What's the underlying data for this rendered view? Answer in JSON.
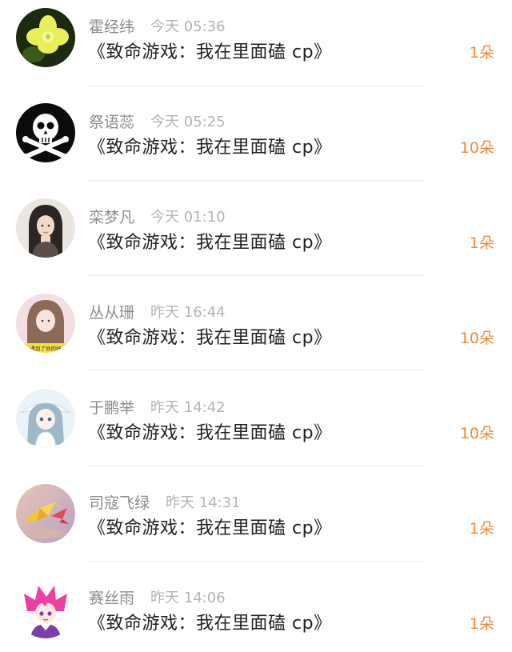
{
  "comments": [
    {
      "user": "霍经纬",
      "time": "今天 05:36",
      "title": "《致命游戏：我在里面磕 cp》",
      "gift": "1朵",
      "avatar_icon": "yellow-flower-avatar"
    },
    {
      "user": "祭语蕊",
      "time": "今天 05:25",
      "title": "《致命游戏：我在里面磕 cp》",
      "gift": "10朵",
      "avatar_icon": "skull-crossbones-avatar"
    },
    {
      "user": "栾梦凡",
      "time": "今天 01:10",
      "title": "《致命游戏：我在里面磕 cp》",
      "gift": "1朵",
      "avatar_icon": "girl-portrait-avatar"
    },
    {
      "user": "丛从珊",
      "time": "昨天 16:44",
      "title": "《致命游戏：我在里面磕 cp》",
      "gift": "10朵",
      "avatar_icon": "girl-photo-avatar",
      "avatar_caption": "遇到了你的好"
    },
    {
      "user": "于鹏举",
      "time": "昨天 14:42",
      "title": "《致命游戏：我在里面磕 cp》",
      "gift": "10朵",
      "avatar_icon": "anime-girl-avatar"
    },
    {
      "user": "司寇飞绿",
      "time": "昨天 14:31",
      "title": "《致命游戏：我在里面磕 cp》",
      "gift": "1朵",
      "avatar_icon": "paper-crane-avatar"
    },
    {
      "user": "赛丝雨",
      "time": "昨天 14:06",
      "title": "《致命游戏：我在里面磕 cp》",
      "gift": "1朵",
      "avatar_icon": "pink-hair-anime-avatar"
    }
  ],
  "colors": {
    "gift": "#f08a3c",
    "username": "#8c8c8c",
    "time": "#b4b4b4",
    "title": "#222222"
  }
}
